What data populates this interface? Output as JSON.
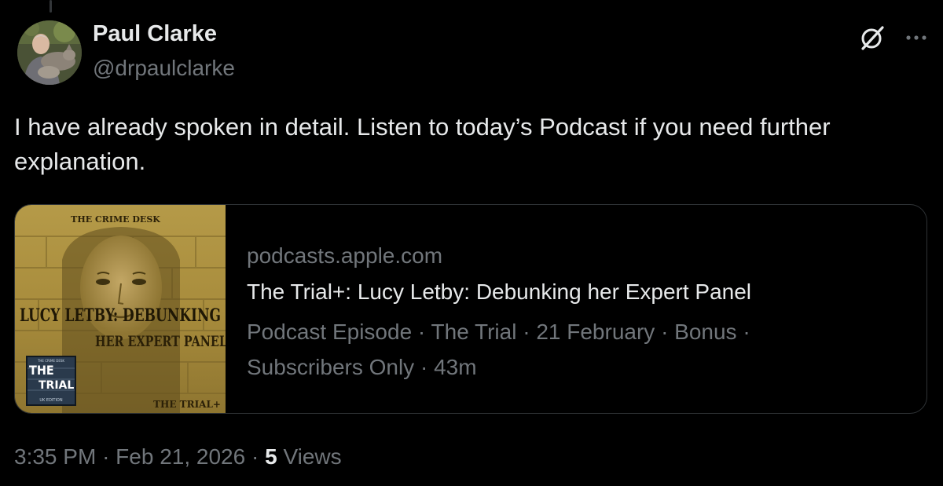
{
  "author": {
    "name": "Paul Clarke",
    "handle": "@drpaulclarke"
  },
  "icons": {
    "grok": "grok-icon",
    "more": "more-icon",
    "avatar": "avatar"
  },
  "tweet": {
    "text": "I have already spoken in detail. Listen to today’s Podcast if you need further explanation."
  },
  "link_card": {
    "domain": "podcasts.apple.com",
    "title": "The Trial+: Lucy Letby: Debunking her Expert Panel",
    "meta_line1": "Podcast Episode · The Trial · 21 February · Bonus ·",
    "meta_line2": "Subscribers Only · 43m",
    "thumbnail": {
      "top_label": "THE CRIME DESK",
      "headline1": "LUCY LETBY: DEBUNKING",
      "headline2": "HER EXPERT PANEL",
      "logo_top": "THE",
      "logo_bottom": "TRIAL",
      "logo_small_top": "THE CRIME DESK",
      "logo_small_bottom": "UK EDITION",
      "footer": "THE TRIAL+"
    }
  },
  "footer": {
    "time": "3:35 PM",
    "separator": "·",
    "date": "Feb 21, 2026",
    "views_count": "5",
    "views_label": "Views"
  },
  "colors": {
    "background": "#000000",
    "primary_text": "#e7e9ea",
    "secondary_text": "#71767b",
    "border": "#2f3336"
  }
}
